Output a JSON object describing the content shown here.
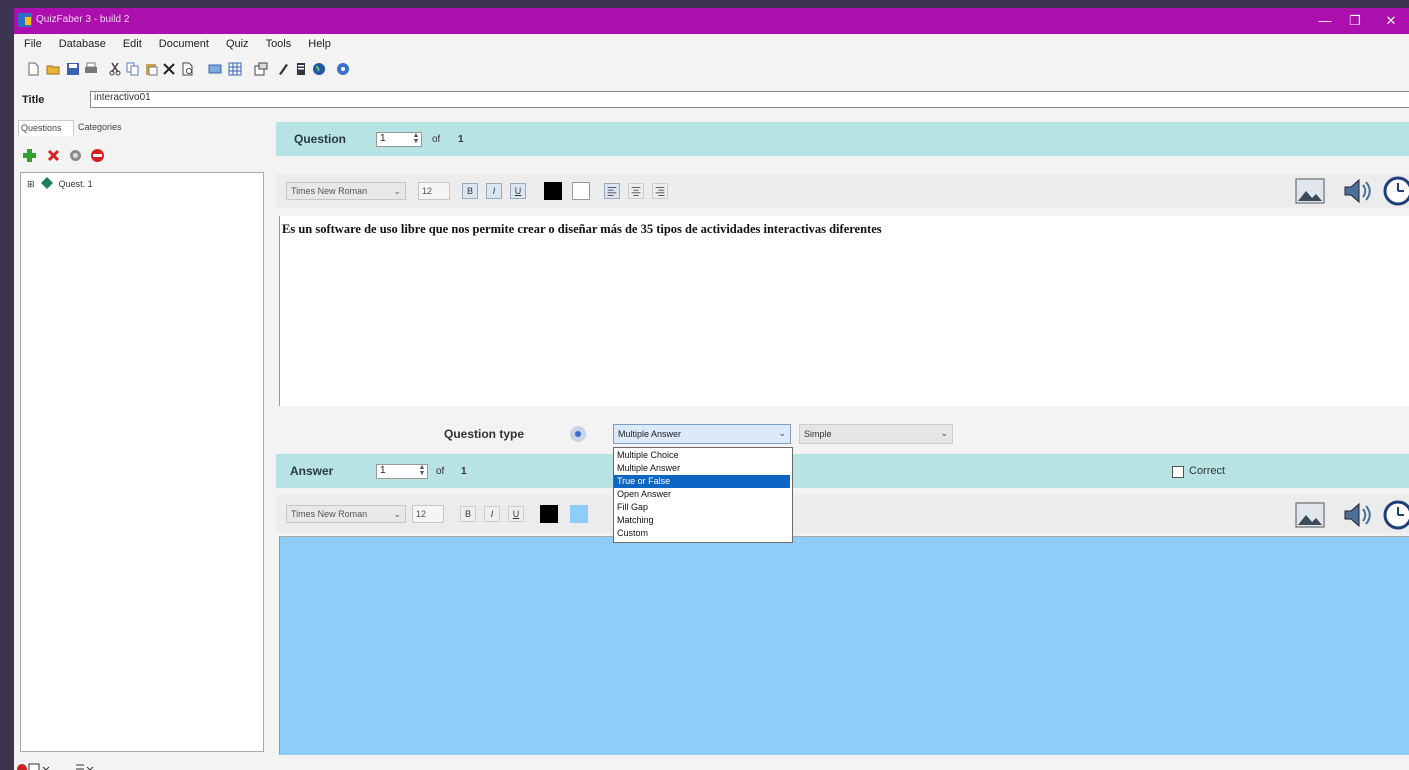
{
  "window": {
    "title": "QuizFaber 3 - build 2",
    "minimize_glyph": "—",
    "restore_glyph": "❐",
    "close_glyph": "✕"
  },
  "menu": [
    "File",
    "Database",
    "Edit",
    "Document",
    "Quiz",
    "Tools",
    "Help"
  ],
  "title_field": {
    "label": "Title",
    "value": "interactivo01"
  },
  "left_tabs": [
    "Questions",
    "Categories"
  ],
  "question_tree": [
    {
      "label": "Quest. 1",
      "expander": "⊞"
    }
  ],
  "question_section": {
    "label": "Question",
    "current": "1",
    "of_label": "of",
    "total": "1",
    "font": "Times New Roman",
    "size": "12",
    "bold": "B",
    "italic": "I",
    "underline": "U",
    "text": "Es un software de uso libre que nos permite crear o diseñar más de 35 tipos de actividades interactivas diferentes"
  },
  "question_type": {
    "label": "Question type",
    "selected": "Multiple Answer",
    "secondary": "Simple",
    "options": [
      "Multiple Choice",
      "Multiple Answer",
      "True or False",
      "Open Answer",
      "Fill Gap",
      "Matching",
      "Custom"
    ],
    "highlighted_index": 2
  },
  "answer_section": {
    "label": "Answer",
    "current": "1",
    "of_label": "of",
    "total": "1",
    "font": "Times New Roman",
    "size": "12",
    "bold": "B",
    "italic": "I",
    "underline": "U",
    "correct_label": "Correct"
  },
  "colors": {
    "titlebar": "#ad0faf",
    "section_bar": "#b7e3e4",
    "answer_bg": "#8ecdf7",
    "selection": "#0d66c3"
  },
  "icons": {
    "toolbar": [
      "new-icon",
      "open-icon",
      "save-icon",
      "print-icon",
      "cut-icon",
      "copy-icon",
      "paste-icon",
      "delete-icon",
      "preview-icon",
      "table-icon",
      "grid-icon",
      "properties-icon",
      "edit-icon",
      "book-icon",
      "globe-icon",
      "help-icon"
    ],
    "question_actions": [
      "add-question-icon",
      "remove-question-icon",
      "settings-icon",
      "stop-icon"
    ],
    "media": [
      "image-icon",
      "audio-icon",
      "timer-icon"
    ]
  }
}
